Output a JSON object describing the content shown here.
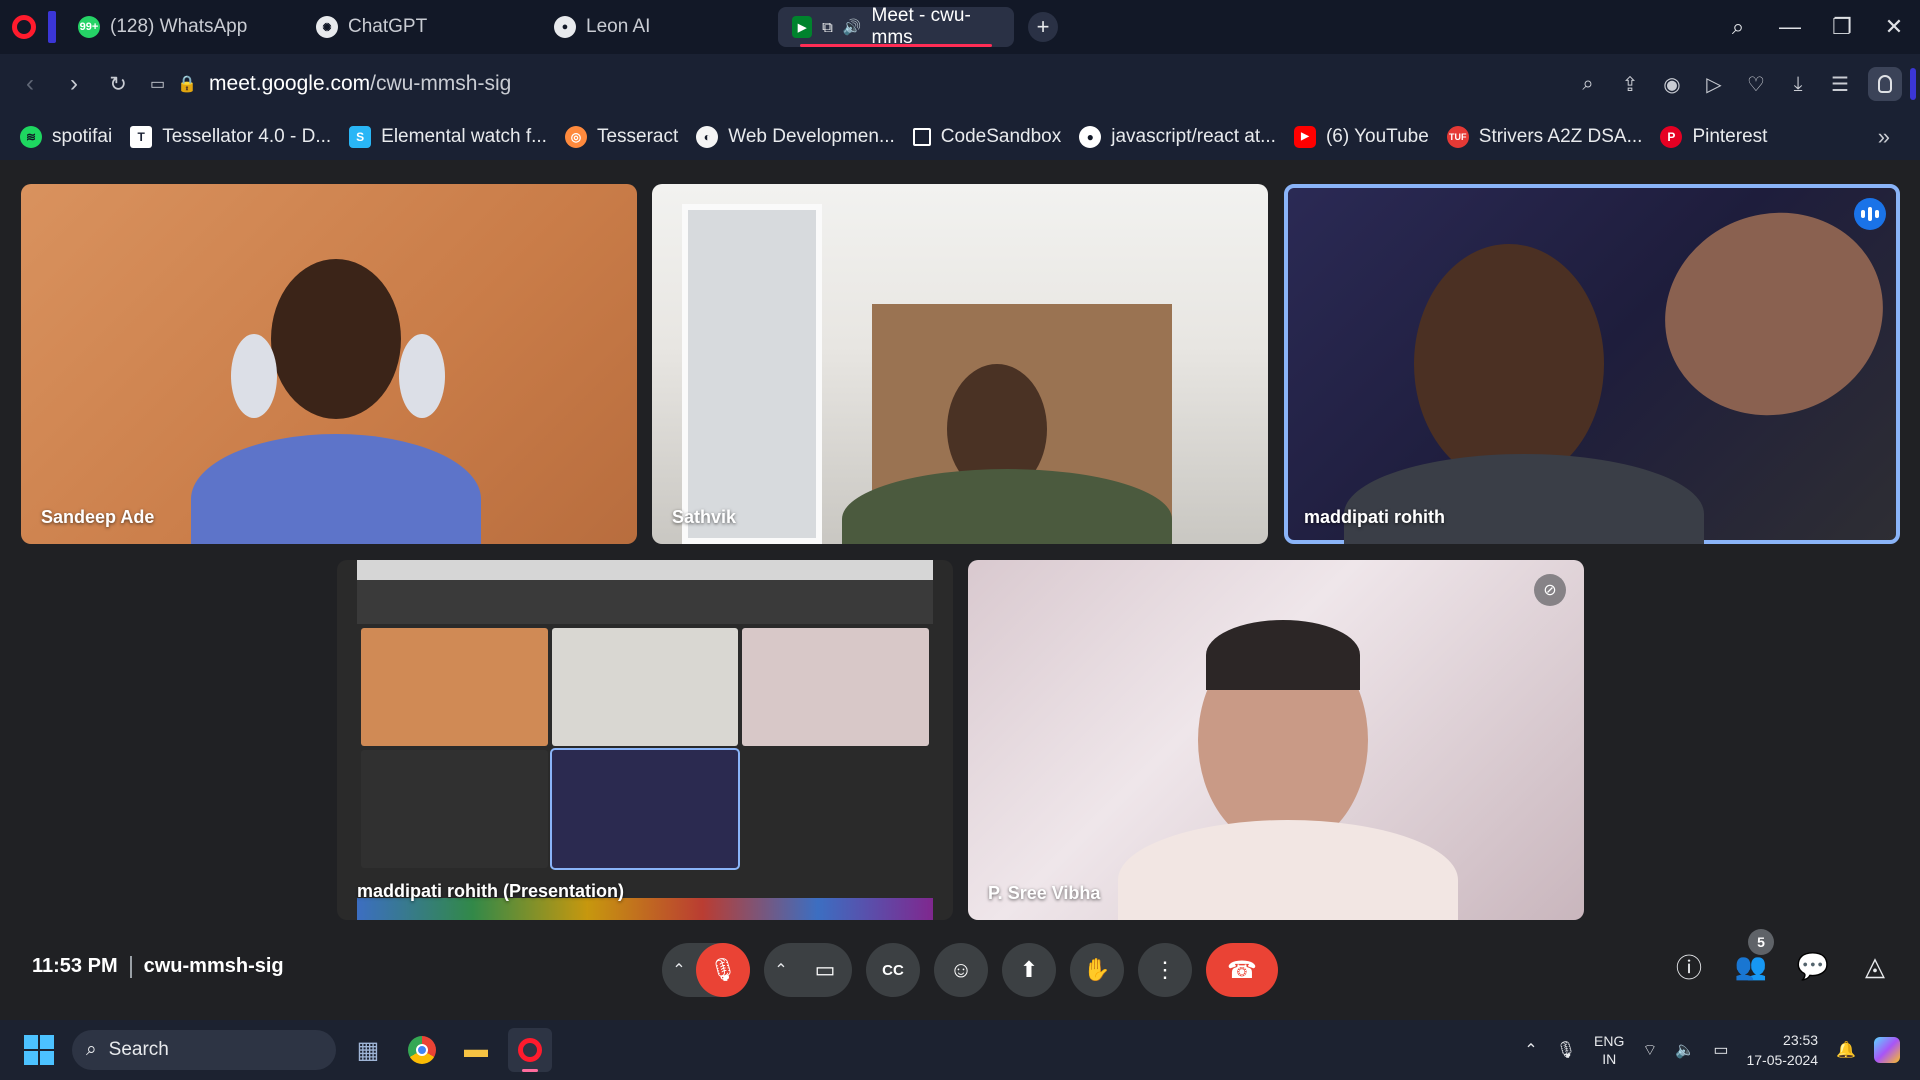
{
  "browser": {
    "tabs": [
      {
        "title": "(128) WhatsApp",
        "icon": "whatsapp-icon",
        "badge": "99+",
        "active": false
      },
      {
        "title": "ChatGPT",
        "icon": "chatgpt-icon",
        "active": false
      },
      {
        "title": "Leon AI",
        "icon": "github-icon",
        "active": false
      },
      {
        "title": "Meet - cwu-mms",
        "icon": "meet-icon",
        "active": true
      }
    ],
    "url_domain": "meet.google.com",
    "url_path": "/cwu-mmsh-sig",
    "bookmarks": [
      {
        "label": "spotifai",
        "icon": "spotify-icon",
        "color": "#1ed760"
      },
      {
        "label": "Tessellator 4.0 - D...",
        "icon": "tessellator-icon",
        "color": "#ffffff"
      },
      {
        "label": "Elemental watch f...",
        "icon": "elemental-icon",
        "color": "#29b6f6"
      },
      {
        "label": "Tesseract",
        "icon": "tesseract-icon",
        "color": "#ff8a3d"
      },
      {
        "label": "Web Developmen...",
        "icon": "webdev-icon",
        "color": "#f5f5f5"
      },
      {
        "label": "CodeSandbox",
        "icon": "codesandbox-icon",
        "color": "#ffffff"
      },
      {
        "label": "javascript/react at...",
        "icon": "github-icon",
        "color": "#ffffff"
      },
      {
        "label": "(6) YouTube",
        "icon": "youtube-icon",
        "color": "#ff0000"
      },
      {
        "label": "Strivers A2Z DSA...",
        "icon": "tuf-icon",
        "color": "#e53935"
      },
      {
        "label": "Pinterest",
        "icon": "pinterest-icon",
        "color": "#e60023"
      }
    ]
  },
  "meet": {
    "participants": [
      {
        "name": "Sandeep Ade",
        "speaking": false,
        "muted": false
      },
      {
        "name": "Sathvik",
        "speaking": false,
        "muted": false
      },
      {
        "name": "maddipati rohith",
        "speaking": true,
        "muted": false
      },
      {
        "name": "maddipati rohith (Presentation)",
        "speaking": false,
        "muted": false
      },
      {
        "name": "P. Sree Vibha",
        "speaking": false,
        "muted": true
      }
    ],
    "time": "11:53 PM",
    "meeting_code": "cwu-mmsh-sig",
    "people_count": "5",
    "accent": "#8ab4f8",
    "end_call_color": "#ea4335"
  },
  "taskbar": {
    "search_placeholder": "Search",
    "lang_top": "ENG",
    "lang_bottom": "IN",
    "time": "23:53",
    "date": "17-05-2024"
  }
}
